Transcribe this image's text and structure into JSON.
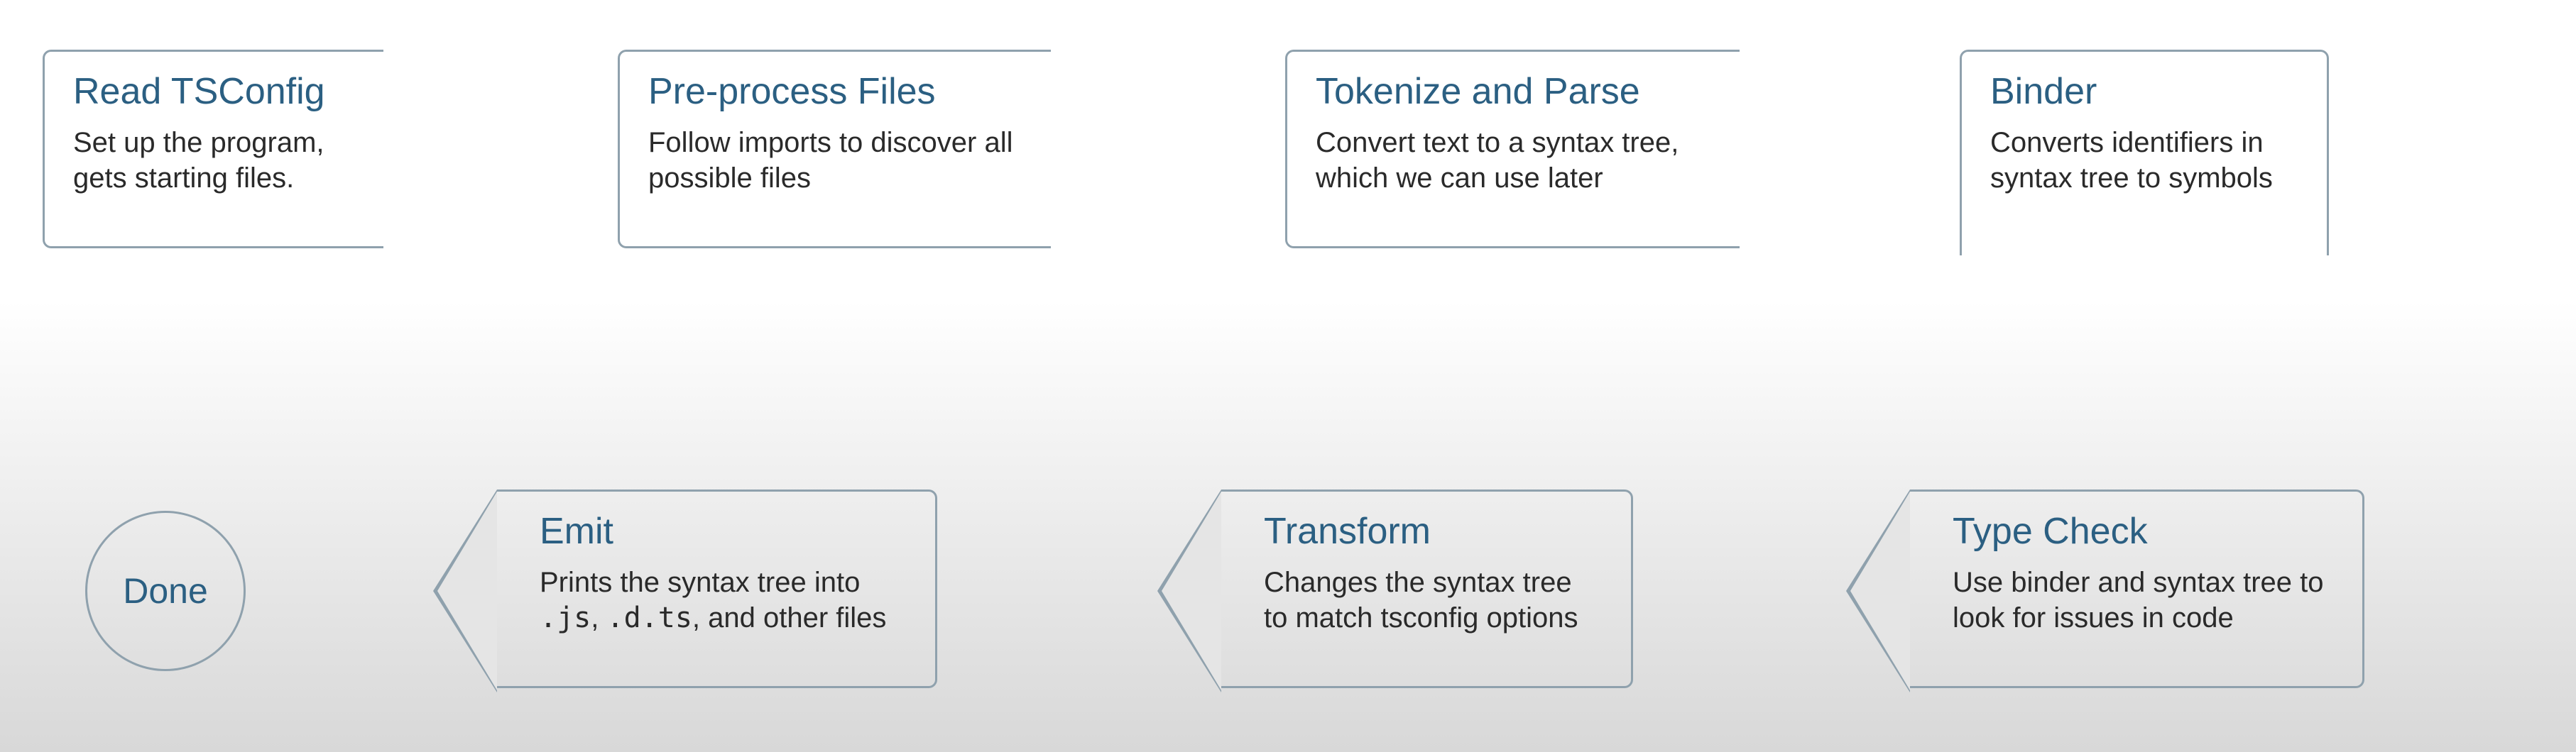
{
  "steps": {
    "read_tsconfig": {
      "title": "Read TSConfig",
      "desc": "Set up the program, gets starting files."
    },
    "preprocess": {
      "title": "Pre-process Files",
      "desc": "Follow imports to discover all possible files"
    },
    "tokenize": {
      "title": "Tokenize and Parse",
      "desc": "Convert text to a syntax tree, which we can use later"
    },
    "binder": {
      "title": "Binder",
      "desc": "Converts identifiers in syntax tree to symbols"
    },
    "type_check": {
      "title": "Type Check",
      "desc": "Use binder and syntax tree to look for issues in code"
    },
    "transform": {
      "title": "Transform",
      "desc": "Changes the syntax tree to match tsconfig options"
    },
    "emit": {
      "title": "Emit",
      "desc_prefix": "Prints the syntax tree into ",
      "desc_code1": ".js",
      "desc_sep": ", ",
      "desc_code2": ".d.ts",
      "desc_suffix": ", and other files"
    },
    "done": {
      "title": "Done"
    }
  },
  "chart_data": {
    "type": "flow",
    "nodes": [
      {
        "id": "read_tsconfig",
        "label": "Read TSConfig",
        "detail": "Set up the program, gets starting files."
      },
      {
        "id": "preprocess",
        "label": "Pre-process Files",
        "detail": "Follow imports to discover all possible files"
      },
      {
        "id": "tokenize",
        "label": "Tokenize and Parse",
        "detail": "Convert text to a syntax tree, which we can use later"
      },
      {
        "id": "binder",
        "label": "Binder",
        "detail": "Converts identifiers in syntax tree to symbols"
      },
      {
        "id": "type_check",
        "label": "Type Check",
        "detail": "Use binder and syntax tree to look for issues in code"
      },
      {
        "id": "transform",
        "label": "Transform",
        "detail": "Changes the syntax tree to match tsconfig options"
      },
      {
        "id": "emit",
        "label": "Emit",
        "detail": "Prints the syntax tree into .js, .d.ts, and other files"
      },
      {
        "id": "done",
        "label": "Done"
      }
    ],
    "edges": [
      [
        "read_tsconfig",
        "preprocess"
      ],
      [
        "preprocess",
        "tokenize"
      ],
      [
        "tokenize",
        "binder"
      ],
      [
        "binder",
        "type_check"
      ],
      [
        "type_check",
        "transform"
      ],
      [
        "transform",
        "emit"
      ],
      [
        "emit",
        "done"
      ]
    ]
  },
  "colors": {
    "title": "#2b5f82",
    "border": "#8fa1ad",
    "text": "#2a2a2a"
  }
}
